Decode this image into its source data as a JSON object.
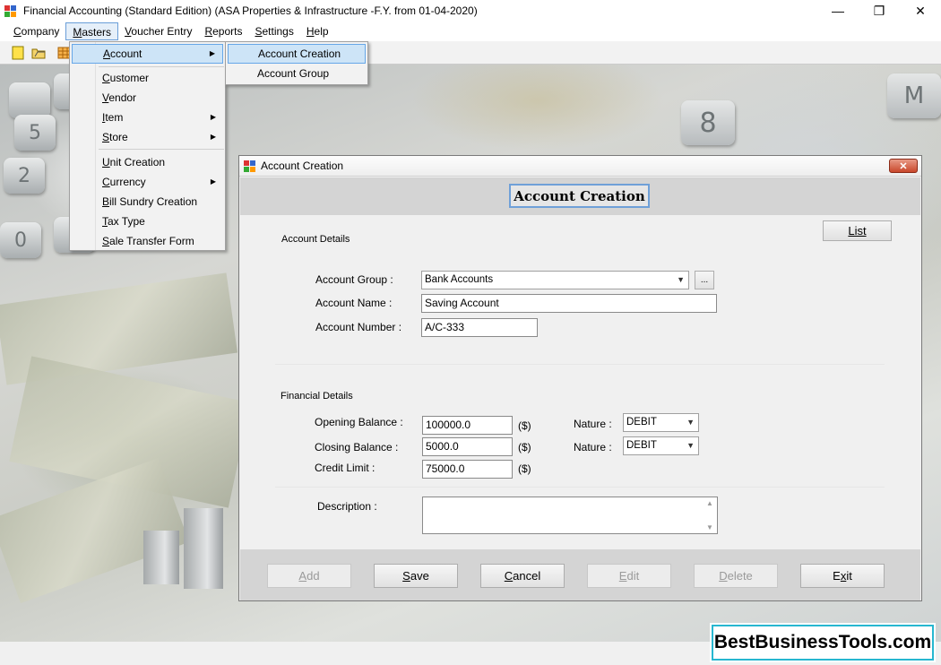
{
  "window": {
    "title": "Financial Accounting (Standard Edition) (ASA Properties & Infrastructure -F.Y.  from 01-04-2020)",
    "minimize": "—",
    "maximize": "❐",
    "close": "✕"
  },
  "menubar": {
    "items": [
      {
        "label": "Company",
        "ul": "C",
        "rest": "ompany"
      },
      {
        "label": "Masters",
        "ul": "M",
        "rest": "asters"
      },
      {
        "label": "Voucher Entry",
        "ul": "V",
        "rest": "oucher Entry"
      },
      {
        "label": "Reports",
        "ul": "R",
        "rest": "eports"
      },
      {
        "label": "Settings",
        "ul": "S",
        "rest": "ettings"
      },
      {
        "label": "Help",
        "ul": "H",
        "rest": "elp"
      }
    ]
  },
  "masters_menu": {
    "items": [
      {
        "label": "Account",
        "ul": "A",
        "rest": "ccount",
        "submenu": true,
        "highlighted": true
      },
      {
        "label": "Customer",
        "ul": "C",
        "rest": "ustomer"
      },
      {
        "label": "Vendor",
        "ul": "V",
        "rest": "endor"
      },
      {
        "label": "Item",
        "ul": "I",
        "rest": "tem",
        "submenu": true
      },
      {
        "label": "Store",
        "ul": "S",
        "rest": "tore",
        "submenu": true
      },
      {
        "label": "Unit Creation",
        "ul": "U",
        "rest": "nit Creation"
      },
      {
        "label": "Currency",
        "ul": "C",
        "rest": "urrency",
        "submenu": true
      },
      {
        "label": "Bill Sundry Creation",
        "ul": "B",
        "rest": "ill Sundry Creation"
      },
      {
        "label": "Tax Type",
        "ul": "T",
        "rest": "ax Type"
      },
      {
        "label": "Sale Transfer Form",
        "ul": "S",
        "rest": "ale Transfer Form"
      }
    ]
  },
  "account_submenu": {
    "items": [
      {
        "label": "Account Creation",
        "highlighted": true
      },
      {
        "label": "Account Group"
      }
    ]
  },
  "dialog": {
    "title": "Account Creation",
    "heading": "Account Creation",
    "list_button": "List",
    "account_details_label": "Account Details",
    "account_group_label": "Account Group :",
    "account_group_value": "Bank Accounts",
    "browse_button": "...",
    "account_name_label": "Account Name :",
    "account_name_value": "Saving Account",
    "account_number_label": "Account Number :",
    "account_number_value": "A/C-333",
    "financial_details_label": "Financial Details",
    "opening_balance_label": "Opening Balance :",
    "opening_balance_value": "100000.0",
    "closing_balance_label": "Closing Balance :",
    "closing_balance_value": "5000.0",
    "credit_limit_label": "Credit Limit :",
    "credit_limit_value": "75000.0",
    "currency_symbol": "($)",
    "nature_label": "Nature :",
    "opening_nature_value": "DEBIT",
    "closing_nature_value": "DEBIT",
    "description_label": "Description :",
    "description_value": "",
    "buttons": {
      "add": {
        "ul": "A",
        "rest": "dd"
      },
      "save": {
        "ul": "S",
        "rest": "ave"
      },
      "cancel": {
        "ul": "C",
        "rest": "ancel"
      },
      "edit": {
        "ul": "E",
        "rest": "dit"
      },
      "delete": {
        "ul": "D",
        "rest": "elete"
      },
      "exit": {
        "pre": "E",
        "ul": "x",
        "rest": "it"
      }
    }
  },
  "watermark": "BestBusinessTools.com",
  "background_keys": [
    "5",
    "2",
    "0",
    "8",
    "M"
  ]
}
